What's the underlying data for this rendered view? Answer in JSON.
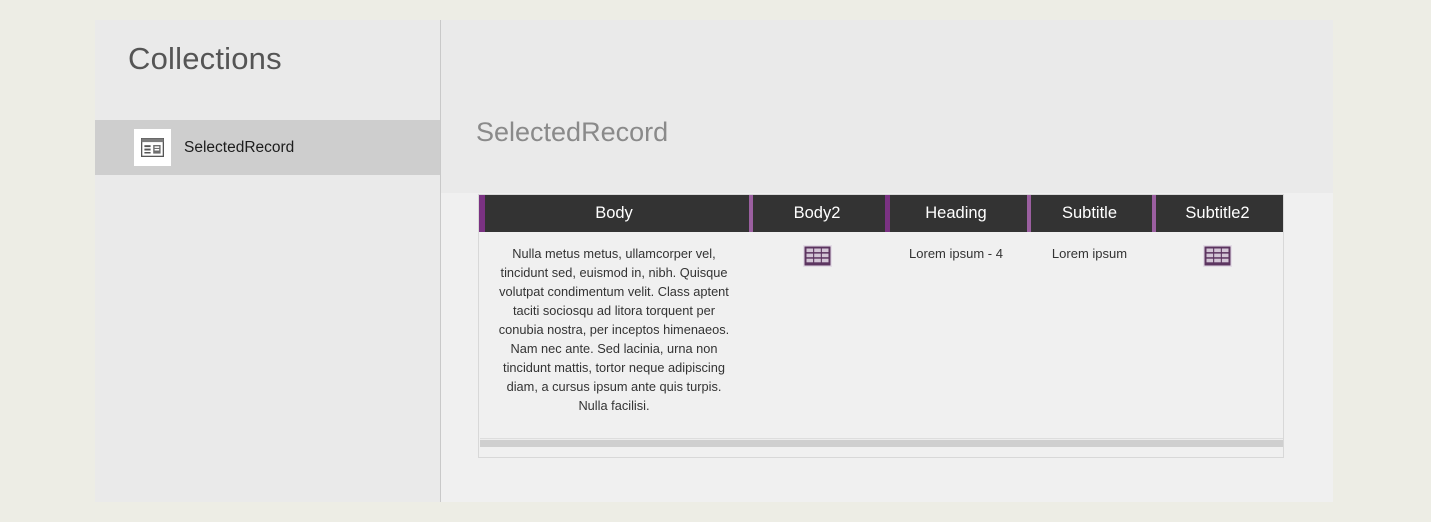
{
  "window": {
    "background_color": "#EDEDE5",
    "panel_color": "#EAEAEA",
    "content_color": "#F0F0F0"
  },
  "sidebar": {
    "title": "Collections",
    "items": [
      {
        "label": "SelectedRecord",
        "icon": "collection-record-icon",
        "selected": true
      }
    ]
  },
  "main": {
    "title": "SelectedRecord",
    "table": {
      "accent_color": "#9B5FA0",
      "header_color": "#333333",
      "columns": [
        "Body",
        "Body2",
        "Heading",
        "Subtitle",
        "Subtitle2"
      ],
      "rows": [
        {
          "Body": "Nulla metus metus, ullamcorper vel, tincidunt sed, euismod in, nibh. Quisque volutpat condimentum velit. Class aptent taciti sociosqu ad litora torquent per conubia nostra, per inceptos himenaeos. Nam nec ante. Sed lacinia, urna non tincidunt mattis, tortor neque adipiscing diam, a cursus ipsum ante quis turpis. Nulla facilisi.",
          "Body2": "table-grid-icon",
          "Heading": "Lorem ipsum - 4",
          "Subtitle": "Lorem ipsum",
          "Subtitle2": "table-grid-icon"
        }
      ],
      "scrollbar": {
        "orientation": "horizontal",
        "visible": true
      }
    }
  }
}
